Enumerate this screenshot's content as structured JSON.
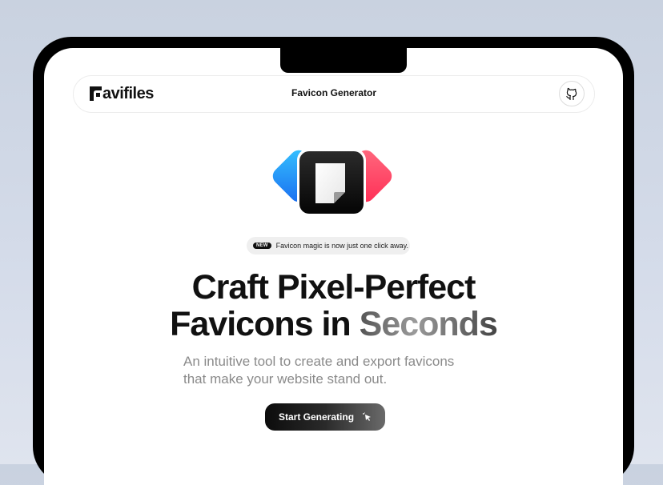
{
  "brand": {
    "name": "avifiles",
    "logo_icon": "favifiles-logo-icon"
  },
  "nav": {
    "title": "Favicon Generator",
    "github_icon": "github-icon"
  },
  "hero": {
    "icon": "favicon-app-icon",
    "badge_tag": "NEW",
    "badge_text": "Favicon magic is now just one click away.",
    "headline_line1": "Craft Pixel-Perfect",
    "headline_line2_plain": "Favicons in ",
    "headline_line2_gradient": "Seconds",
    "subtitle_line1": "An intuitive tool to create and export favicons",
    "subtitle_line2": "that make your website stand out.",
    "cta_label": "Start Generating",
    "cta_icon": "cursor-sparkle-icon"
  },
  "colors": {
    "background": "#d5dcea",
    "device_frame": "#000000",
    "text_primary": "#111111",
    "text_muted": "#8a8a8a",
    "accent_blue": "#1ea7f2",
    "accent_red": "#ff3b5c"
  }
}
